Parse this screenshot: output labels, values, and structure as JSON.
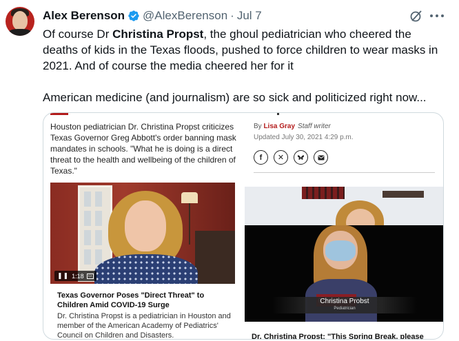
{
  "tweet": {
    "author_name": "Alex Berenson",
    "handle": "@AlexBerenson",
    "separator": "·",
    "date": "Jul 7",
    "text_p1_a": "Of course Dr ",
    "text_p1_bold": "Christina Propst",
    "text_p1_b": ", the ghoul pediatrician who cheered the deaths of kids in the Texas floods, pushed to force children to wear masks in 2021. And of course the media cheered her for it",
    "text_p2": "American medicine (and journalism) are so sick and politicized right now..."
  },
  "icons": {
    "verified": "verified-badge-icon",
    "grok": "grok-icon",
    "more": "more-icon"
  },
  "article": {
    "lead": "Houston pediatrician Dr. Christina Propst criticizes Texas Governor Greg Abbott's order banning mask mandates in schools. \"What he is doing is a direct threat to the health and wellbeing of the children of Texas.\"",
    "by_prefix": "By ",
    "author": "Lisa Gray",
    "author_role": "Staff writer",
    "updated": "Updated July 30, 2021 4:29 p.m.",
    "share_icons": [
      "facebook-icon",
      "x-icon",
      "bluesky-icon",
      "email-icon"
    ]
  },
  "video1": {
    "time": "1:18",
    "title": "Texas Governor Poses \"Direct Threat\" to Children Amid COVID-19 Surge",
    "description": "Dr. Christina Propst is a pediatrician in Houston and member of the American Academy of Pediatrics' Council on Children and Disasters."
  },
  "video2": {
    "lower_third_name": "Christina Probst",
    "lower_third_role": "Pediatrician",
    "badge_text": "EDUCATED",
    "title": "Dr. Christina Propst: \"This Spring Break, please"
  },
  "colors": {
    "verified_blue": "#1d9bf0",
    "muted_text": "#536471",
    "author_red": "#b31b1b"
  }
}
